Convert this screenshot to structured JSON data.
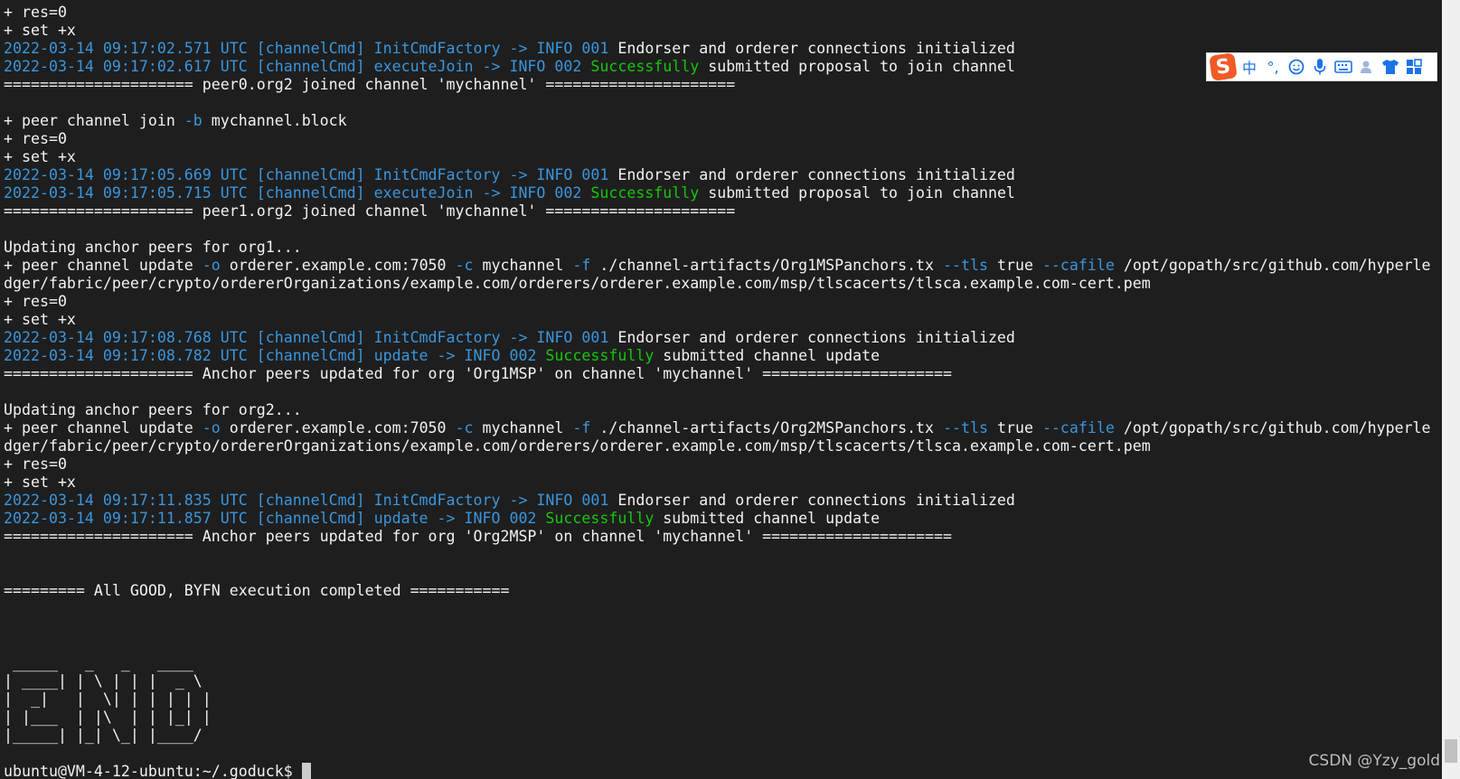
{
  "terminal": {
    "colors": {
      "white": "#f2f2f2",
      "cyan": "#3a96dd",
      "green": "#16c60c",
      "background": "#1e1e1e"
    },
    "lines": [
      [
        [
          "+ res=0",
          "w"
        ]
      ],
      [
        [
          "+ set +x",
          "w"
        ]
      ],
      [
        [
          "2022-03-14 09:17:02.571 UTC [channelCmd] InitCmdFactory -> INFO 001 ",
          "c"
        ],
        [
          "Endorser and orderer connections initialized",
          "w"
        ]
      ],
      [
        [
          "2022-03-14 09:17:02.617 UTC [channelCmd] executeJoin -> INFO 002 ",
          "c"
        ],
        [
          "Successfully",
          "g"
        ],
        [
          " submitted proposal to join channel",
          "w"
        ]
      ],
      [
        [
          "===================== peer0.org2 joined channel 'mychannel' =====================",
          "w"
        ]
      ],
      [
        [
          "",
          "w"
        ]
      ],
      [
        [
          "+ peer channel join ",
          "w"
        ],
        [
          "-b",
          "c"
        ],
        [
          " mychannel.block",
          "w"
        ]
      ],
      [
        [
          "+ res=0",
          "w"
        ]
      ],
      [
        [
          "+ set +x",
          "w"
        ]
      ],
      [
        [
          "2022-03-14 09:17:05.669 UTC [channelCmd] InitCmdFactory -> INFO 001 ",
          "c"
        ],
        [
          "Endorser and orderer connections initialized",
          "w"
        ]
      ],
      [
        [
          "2022-03-14 09:17:05.715 UTC [channelCmd] executeJoin -> INFO 002 ",
          "c"
        ],
        [
          "Successfully",
          "g"
        ],
        [
          " submitted proposal to join channel",
          "w"
        ]
      ],
      [
        [
          "===================== peer1.org2 joined channel 'mychannel' =====================",
          "w"
        ]
      ],
      [
        [
          "",
          "w"
        ]
      ],
      [
        [
          "Updating anchor peers for org1...",
          "w"
        ]
      ],
      [
        [
          "+ peer channel update ",
          "w"
        ],
        [
          "-o",
          "c"
        ],
        [
          " orderer.example.com:7050 ",
          "w"
        ],
        [
          "-c",
          "c"
        ],
        [
          " mychannel ",
          "w"
        ],
        [
          "-f",
          "c"
        ],
        [
          " ./channel-artifacts/Org1MSPanchors.tx ",
          "w"
        ],
        [
          "--tls",
          "c"
        ],
        [
          " true ",
          "w"
        ],
        [
          "--cafile",
          "c"
        ],
        [
          " /opt/gopath/src/github.com/hyperle",
          "w"
        ]
      ],
      [
        [
          "dger/fabric/peer/crypto/ordererOrganizations/example.com/orderers/orderer.example.com/msp/tlscacerts/tlsca.example.com-cert.pem",
          "w"
        ]
      ],
      [
        [
          "+ res=0",
          "w"
        ]
      ],
      [
        [
          "+ set +x",
          "w"
        ]
      ],
      [
        [
          "2022-03-14 09:17:08.768 UTC [channelCmd] InitCmdFactory -> INFO 001 ",
          "c"
        ],
        [
          "Endorser and orderer connections initialized",
          "w"
        ]
      ],
      [
        [
          "2022-03-14 09:17:08.782 UTC [channelCmd] update -> INFO 002 ",
          "c"
        ],
        [
          "Successfully",
          "g"
        ],
        [
          " submitted channel update",
          "w"
        ]
      ],
      [
        [
          "===================== Anchor peers updated for org 'Org1MSP' on channel 'mychannel' =====================",
          "w"
        ]
      ],
      [
        [
          "",
          "w"
        ]
      ],
      [
        [
          "Updating anchor peers for org2...",
          "w"
        ]
      ],
      [
        [
          "+ peer channel update ",
          "w"
        ],
        [
          "-o",
          "c"
        ],
        [
          " orderer.example.com:7050 ",
          "w"
        ],
        [
          "-c",
          "c"
        ],
        [
          " mychannel ",
          "w"
        ],
        [
          "-f",
          "c"
        ],
        [
          " ./channel-artifacts/Org2MSPanchors.tx ",
          "w"
        ],
        [
          "--tls",
          "c"
        ],
        [
          " true ",
          "w"
        ],
        [
          "--cafile",
          "c"
        ],
        [
          " /opt/gopath/src/github.com/hyperle",
          "w"
        ]
      ],
      [
        [
          "dger/fabric/peer/crypto/ordererOrganizations/example.com/orderers/orderer.example.com/msp/tlscacerts/tlsca.example.com-cert.pem",
          "w"
        ]
      ],
      [
        [
          "+ res=0",
          "w"
        ]
      ],
      [
        [
          "+ set +x",
          "w"
        ]
      ],
      [
        [
          "2022-03-14 09:17:11.835 UTC [channelCmd] InitCmdFactory -> INFO 001 ",
          "c"
        ],
        [
          "Endorser and orderer connections initialized",
          "w"
        ]
      ],
      [
        [
          "2022-03-14 09:17:11.857 UTC [channelCmd] update -> INFO 002 ",
          "c"
        ],
        [
          "Successfully",
          "g"
        ],
        [
          " submitted channel update",
          "w"
        ]
      ],
      [
        [
          "===================== Anchor peers updated for org 'Org2MSP' on channel 'mychannel' =====================",
          "w"
        ]
      ],
      [
        [
          "",
          "w"
        ]
      ],
      [
        [
          "",
          "w"
        ]
      ],
      [
        [
          "========= All GOOD, BYFN execution completed ===========",
          "w"
        ]
      ],
      [
        [
          "",
          "w"
        ]
      ],
      [
        [
          "",
          "w"
        ]
      ],
      [
        [
          "",
          "w"
        ]
      ],
      [
        [
          " _____   _   _   ____   ",
          "w"
        ]
      ],
      [
        [
          "| ____| | \\ | | |  _ \\  ",
          "w"
        ]
      ],
      [
        [
          "|  _|   |  \\| | | | | | ",
          "w"
        ]
      ],
      [
        [
          "| |___  | |\\  | | |_| | ",
          "w"
        ]
      ],
      [
        [
          "|_____| |_| \\_| |____/  ",
          "w"
        ]
      ],
      [
        [
          "",
          "w"
        ]
      ]
    ],
    "prompt": "ubuntu@VM-4-12-ubuntu:~/.goduck$ "
  },
  "ime_toolbar": {
    "logo_letter": "S",
    "mode_label": "中",
    "punct_label": "°,",
    "icons": [
      "emoji-icon",
      "microphone-icon",
      "keyboard-icon",
      "user-icon",
      "skin-shirt-icon",
      "toolbox-grid-icon"
    ]
  },
  "watermark": "CSDN @Yzy_gold"
}
